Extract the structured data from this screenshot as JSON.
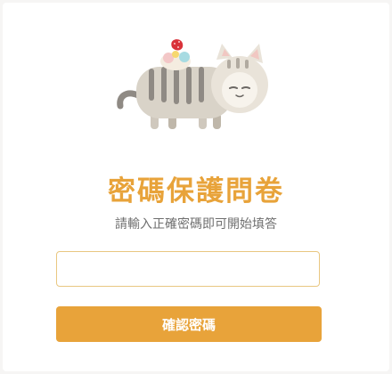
{
  "page": {
    "title": "密碼保護問卷",
    "subtitle": "請輸入正確密碼即可開始填答"
  },
  "form": {
    "password_value": "",
    "password_placeholder": "",
    "submit_label": "確認密碼"
  },
  "colors": {
    "accent": "#e8a33a",
    "input_border": "#e9c781",
    "background": "#f6f5f4"
  },
  "illustration": {
    "icon": "cat-with-strawberry-cake-icon"
  }
}
